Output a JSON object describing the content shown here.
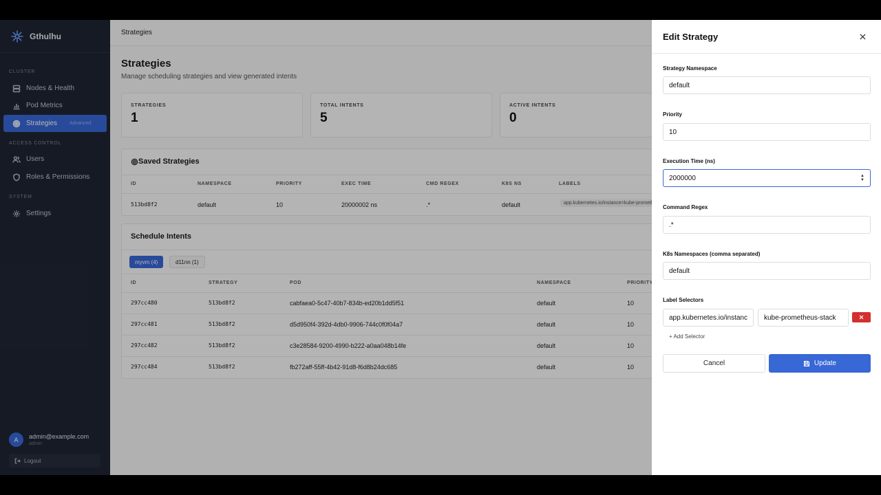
{
  "sidebar": {
    "brand": "Gthulhu",
    "sections": {
      "cluster": "CLUSTER",
      "access": "ACCESS CONTROL",
      "system": "SYSTEM"
    },
    "items": {
      "nodes": "Nodes & Health",
      "pods": "Pod Metrics",
      "strategies": "Strategies",
      "strategies_badge": "Advanced",
      "users": "Users",
      "roles": "Roles & Permissions",
      "settings": "Settings"
    },
    "user": {
      "initial": "A",
      "email": "admin@example.com",
      "role": "admin"
    },
    "logout": "Logout"
  },
  "main": {
    "breadcrumb": "Strategies",
    "title": "Strategies",
    "subtitle": "Manage scheduling strategies and view generated intents",
    "stats": [
      {
        "label": "STRATEGIES",
        "value": "1"
      },
      {
        "label": "TOTAL INTENTS",
        "value": "5"
      },
      {
        "label": "ACTIVE INTENTS",
        "value": "0"
      }
    ],
    "saved": {
      "title": "Saved Strategies",
      "headers": [
        "ID",
        "NAMESPACE",
        "PRIORITY",
        "EXEC TIME",
        "CMD REGEX",
        "K8S NS",
        "LABELS"
      ],
      "row": [
        "513bd8f2",
        "default",
        "10",
        "20000002 ns",
        ".*",
        "default",
        "app.kubernetes.io/instance=kube-prometheus-stack"
      ]
    },
    "intents": {
      "title": "Schedule Intents",
      "tabs": [
        "myvm (4)",
        "d11nn (1)"
      ],
      "headers": [
        "ID",
        "STRATEGY",
        "POD",
        "NAMESPACE",
        "PRIORITY"
      ],
      "rows": [
        [
          "297cc480",
          "513bd8f2",
          "cabfaea0-5c47-40b7-834b-ed20b1dd5f51",
          "default",
          "10"
        ],
        [
          "297cc481",
          "513bd8f2",
          "d5d950f4-392d-4db0-9906-744c0f0f04a7",
          "default",
          "10"
        ],
        [
          "297cc482",
          "513bd8f2",
          "c3e28584-9200-4990-b222-a0aa048b14fe",
          "default",
          "10"
        ],
        [
          "297cc484",
          "513bd8f2",
          "fb272aff-55ff-4b42-91d8-f6d8b24dc685",
          "default",
          "10"
        ]
      ]
    }
  },
  "drawer": {
    "title": "Edit Strategy",
    "fields": {
      "namespace": {
        "label": "Strategy Namespace",
        "value": "default"
      },
      "priority": {
        "label": "Priority",
        "value": "10"
      },
      "exec_time": {
        "label": "Execution Time (ns)",
        "value": "2000000"
      },
      "cmd_regex": {
        "label": "Command Regex",
        "value": ".*"
      },
      "k8s_ns": {
        "label": "K8s Namespaces (comma separated)",
        "value": "default"
      },
      "selectors": {
        "label": "Label Selectors",
        "key": "app.kubernetes.io/instanc",
        "value": "kube-prometheus-stack"
      }
    },
    "add_selector": "+ Add Selector",
    "cancel": "Cancel",
    "update": "Update"
  },
  "colors": {
    "accent": "#3867d6",
    "sidebar": "#1f2533",
    "danger": "#d32f2f"
  }
}
